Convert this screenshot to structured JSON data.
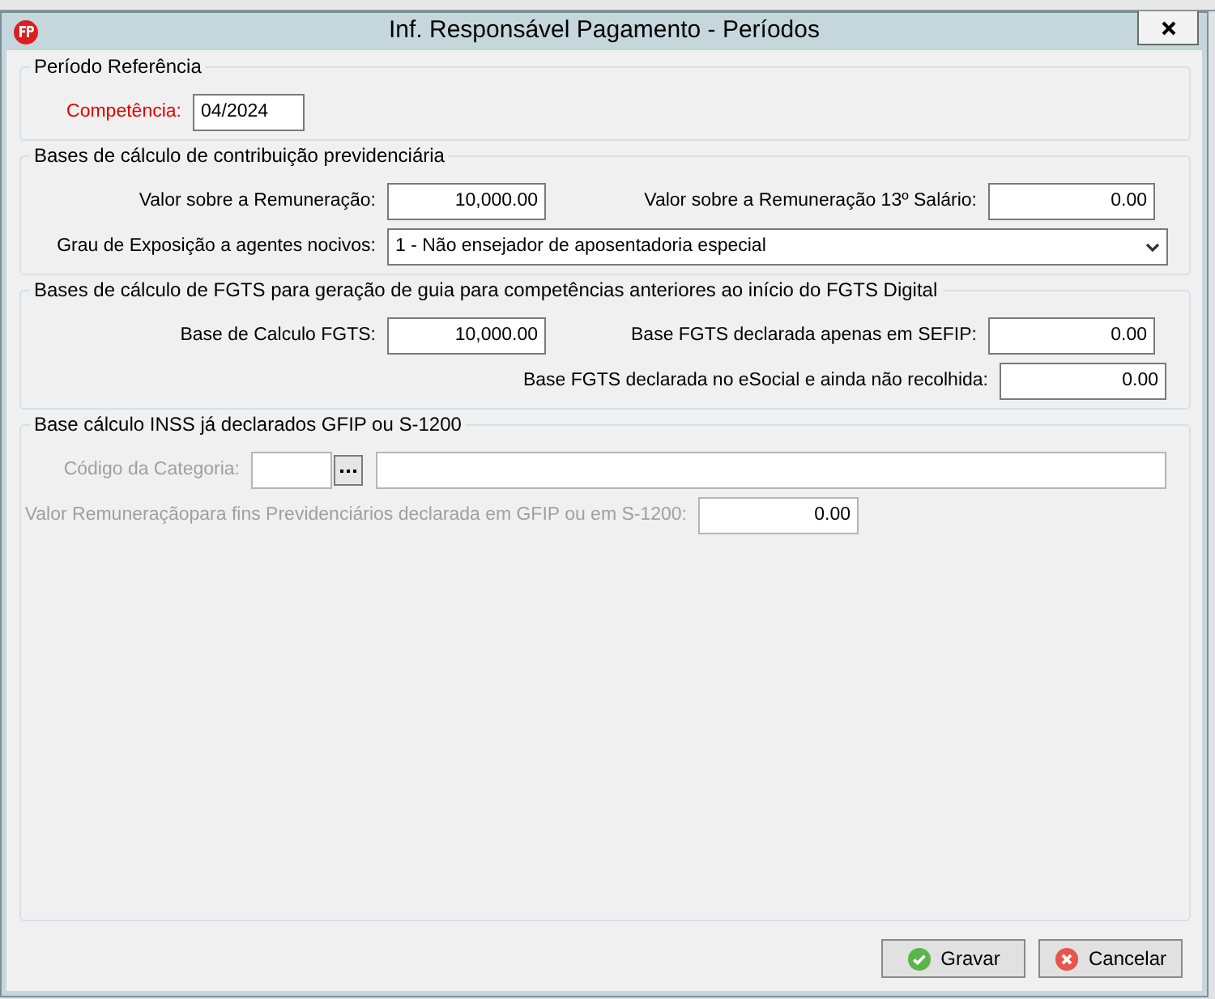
{
  "window": {
    "title": "Inf. Responsável Pagamento - Períodos"
  },
  "groups": [
    {
      "legend": "Período Referência",
      "disabled": false,
      "fields": [
        {
          "kind": "text",
          "label": "Competência:",
          "required": true,
          "value": "04/2024"
        }
      ]
    },
    {
      "legend": "Bases de cálculo de contribuição previdenciária",
      "disabled": false,
      "fields": [
        {
          "kind": "number",
          "label": "Valor sobre a Remuneração:",
          "required": false,
          "value": "10,000.00"
        },
        {
          "kind": "number",
          "label": "Valor sobre a Remuneração 13º Salário:",
          "required": false,
          "value": "0.00"
        },
        {
          "kind": "select",
          "label": "Grau de Exposição a agentes nocivos:",
          "required": false,
          "value": "1 - Não ensejador de aposentadoria especial"
        }
      ]
    },
    {
      "legend": "Bases de cálculo de FGTS para geração de guia para competências anteriores ao início do FGTS Digital",
      "disabled": false,
      "fields": [
        {
          "kind": "number",
          "label": "Base de Calculo FGTS:",
          "required": false,
          "value": "10,000.00"
        },
        {
          "kind": "number",
          "label": "Base FGTS declarada apenas em SEFIP:",
          "required": false,
          "value": "0.00"
        },
        {
          "kind": "number",
          "label": "Base FGTS declarada no eSocial e ainda não recolhida:",
          "required": false,
          "value": "0.00"
        }
      ]
    },
    {
      "legend": "Base cálculo INSS já declarados GFIP ou S-1200",
      "disabled": true,
      "fields": [
        {
          "kind": "lookup",
          "label": "Código da Categoria:",
          "required": false
        },
        {
          "kind": "number",
          "label": "Valor Remuneraçãopara fins Previdenciários declarada em GFIP ou em S-1200:",
          "required": false,
          "value": "0.00"
        }
      ]
    }
  ],
  "buttons": [
    {
      "kind": "ok",
      "label": "Gravar"
    },
    {
      "kind": "cancel",
      "label": "Cancelar"
    }
  ]
}
